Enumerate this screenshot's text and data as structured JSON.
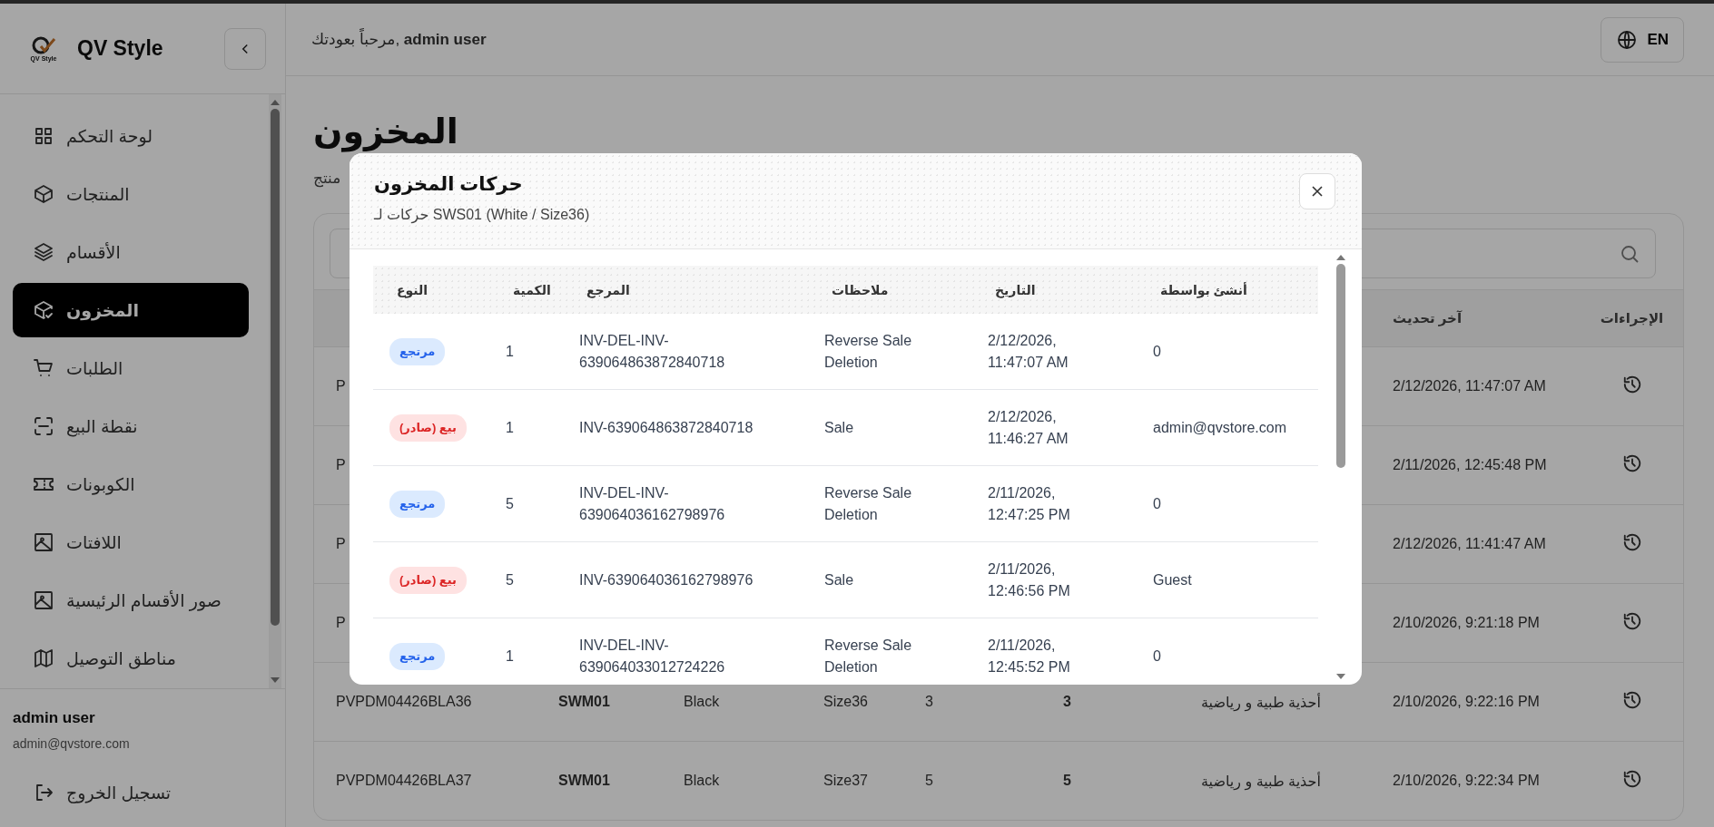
{
  "sidebar": {
    "brand": "QV Style",
    "logo_caption": "QV Style",
    "items": [
      {
        "label": "لوحة التحكم",
        "kind": "dashboard",
        "selected": false
      },
      {
        "label": "المنتجات",
        "kind": "products",
        "selected": false
      },
      {
        "label": "الأقسام",
        "kind": "categories",
        "selected": false
      },
      {
        "label": "المخزون",
        "kind": "inventory",
        "selected": true
      },
      {
        "label": "الطلبات",
        "kind": "orders",
        "selected": false
      },
      {
        "label": "نقطة البيع",
        "kind": "pos",
        "selected": false
      },
      {
        "label": "الكوبونات",
        "kind": "coupons",
        "selected": false
      },
      {
        "label": "اللافتات",
        "kind": "banners",
        "selected": false
      },
      {
        "label": "صور الأقسام الرئيسية",
        "kind": "category_images",
        "selected": false
      },
      {
        "label": "مناطق التوصيل",
        "kind": "delivery",
        "selected": false
      }
    ],
    "user": {
      "name": "admin user",
      "email": "admin@qvstore.com"
    },
    "logout": "تسجيل الخروج"
  },
  "topbar": {
    "greeting": "مرحباً بعودتك, **admin user**",
    "language": "EN"
  },
  "page": {
    "title": "المخزون",
    "subtitle": "منتج"
  },
  "inventory_table": {
    "last_updated_header": "آخر تحديث",
    "actions_header": "الإجراءات",
    "rows": [
      {
        "column_1": "P",
        "last_updated": "2/12/2026, 11:47:07 AM"
      },
      {
        "column_1": "P",
        "last_updated": "2/11/2026, 12:45:48 PM"
      },
      {
        "column_1": "P",
        "last_updated": "2/12/2026, 11:41:47 AM"
      },
      {
        "column_1": "P",
        "last_updated": "2/10/2026, 9:21:18 PM"
      },
      {
        "column_1": "PVPDM04426BLA36",
        "column_2": "SWM01",
        "column_3": "Black",
        "column_4": "Size36",
        "column_5": "3",
        "column_6": "3",
        "column_7": "أحذية طبية و رياضية",
        "last_updated": "2/10/2026, 9:22:16 PM"
      },
      {
        "column_1": "PVPDM04426BLA37",
        "column_2": "SWM01",
        "column_3": "Black",
        "column_4": "Size37",
        "column_5": "5",
        "column_6": "5",
        "column_7": "أحذية طبية و رياضية",
        "last_updated": "2/10/2026, 9:22:34 PM"
      }
    ]
  },
  "modal": {
    "title": "حركات المخزون",
    "subtitle": "حركات لـ SWS01 (White / Size36)",
    "columns": {
      "type": "النوع",
      "quantity": "الكمية",
      "reference": "المرجع",
      "notes": "ملاحظات",
      "date": "التاريخ",
      "created_by": "أنشئ بواسطة"
    },
    "rows": [
      {
        "type": {
          "label": "مرتجع",
          "kind": "return"
        },
        "quantity": "1",
        "reference": "INV-DEL-INV-639064863872840718",
        "notes": "Reverse Sale Deletion",
        "date": "2/12/2026, 11:47:07 AM",
        "created_by": "0"
      },
      {
        "type": {
          "label": "بيع (صادر)",
          "kind": "sale"
        },
        "quantity": "1",
        "reference": "INV-639064863872840718",
        "notes": "Sale",
        "date": "2/12/2026, 11:46:27 AM",
        "created_by": "admin@qvstore.com"
      },
      {
        "type": {
          "label": "مرتجع",
          "kind": "return"
        },
        "quantity": "5",
        "reference": "INV-DEL-INV-639064036162798976",
        "notes": "Reverse Sale Deletion",
        "date": "2/11/2026, 12:47:25 PM",
        "created_by": "0"
      },
      {
        "type": {
          "label": "بيع (صادر)",
          "kind": "sale"
        },
        "quantity": "5",
        "reference": "INV-639064036162798976",
        "notes": "Sale",
        "date": "2/11/2026, 12:46:56 PM",
        "created_by": "Guest"
      },
      {
        "type": {
          "label": "مرتجع",
          "kind": "return"
        },
        "quantity": "1",
        "reference": "INV-DEL-INV-639064033012724226",
        "notes": "Reverse Sale Deletion",
        "date": "2/11/2026, 12:45:52 PM",
        "created_by": "0"
      }
    ]
  }
}
